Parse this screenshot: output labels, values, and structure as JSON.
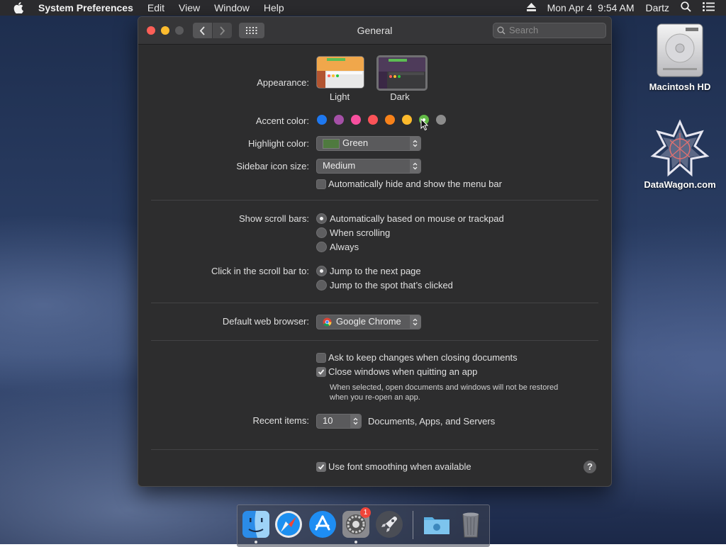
{
  "menubar": {
    "app_name": "System Preferences",
    "menus": [
      "Edit",
      "View",
      "Window",
      "Help"
    ],
    "datetime": "Mon Apr 4  9:54 AM",
    "user": "Dartz"
  },
  "window": {
    "title": "General",
    "search_placeholder": "Search"
  },
  "appearance": {
    "label": "Appearance:",
    "options": [
      "Light",
      "Dark"
    ],
    "selected": "Dark"
  },
  "accent": {
    "label": "Accent color:",
    "colors": [
      "#1e78f0",
      "#a550a7",
      "#f74f9e",
      "#fc5358",
      "#f8821a",
      "#fdba2c",
      "#62ba46",
      "#8c8c8c"
    ],
    "selected_index": 6
  },
  "highlight": {
    "label": "Highlight color:",
    "value": "Green",
    "swatch": "#4f7a3f"
  },
  "sidebar_size": {
    "label": "Sidebar icon size:",
    "value": "Medium"
  },
  "menubar_hide": {
    "label": "Automatically hide and show the menu bar",
    "checked": false
  },
  "scrollbars": {
    "label": "Show scroll bars:",
    "options": [
      "Automatically based on mouse or trackpad",
      "When scrolling",
      "Always"
    ],
    "selected_index": 0
  },
  "scroll_click": {
    "label": "Click in the scroll bar to:",
    "options": [
      "Jump to the next page",
      "Jump to the spot that’s clicked"
    ],
    "selected_index": 0
  },
  "browser": {
    "label": "Default web browser:",
    "value": "Google Chrome"
  },
  "ask_keep": {
    "label": "Ask to keep changes when closing documents",
    "checked": false
  },
  "close_windows": {
    "label": "Close windows when quitting an app",
    "checked": true,
    "note_line1": "When selected, open documents and windows will not be restored",
    "note_line2": "when you re-open an app."
  },
  "recent": {
    "label": "Recent items:",
    "value": "10",
    "suffix": "Documents, Apps, and Servers"
  },
  "font_smoothing": {
    "label": "Use font smoothing when available",
    "checked": true
  },
  "help_label": "?",
  "desktop": {
    "hd_label": "Macintosh HD",
    "dw_label": "DataWagon.com"
  },
  "dock": {
    "badge": "1"
  }
}
